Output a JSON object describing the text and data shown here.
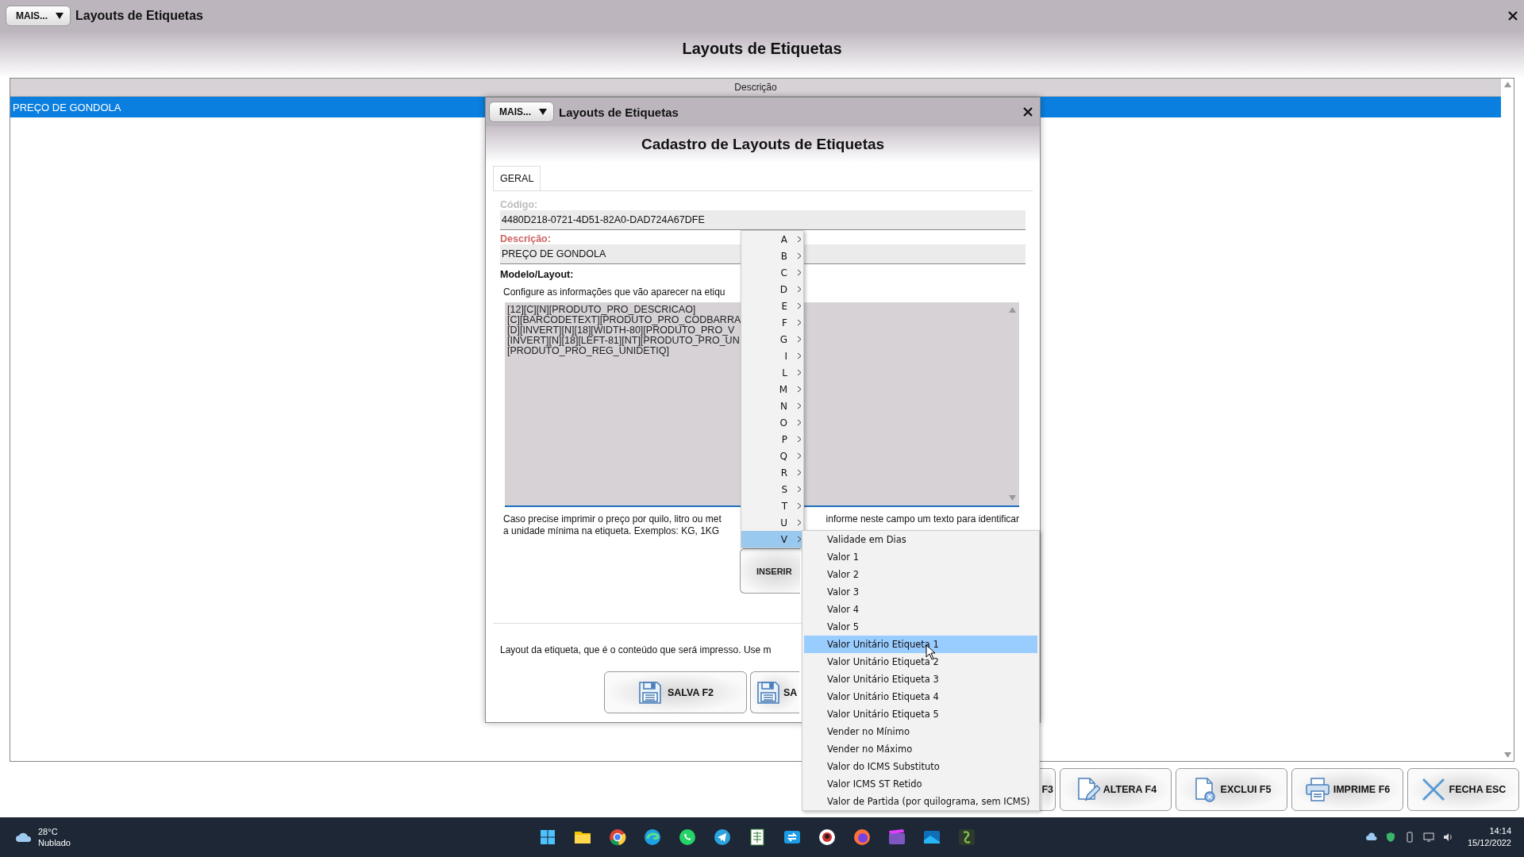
{
  "main_window": {
    "menu_button": "MAIS...",
    "title": "Layouts de Etiquetas",
    "heading": "Layouts de Etiquetas",
    "table": {
      "columns": [
        "Descrição"
      ],
      "rows": [
        {
          "cells": [
            "PREÇO DE GONDOLA"
          ],
          "selected": true
        }
      ]
    },
    "toolbar": [
      {
        "label": "F3",
        "kind": "covered"
      },
      {
        "label": "ALTERA F4",
        "kind": "edit"
      },
      {
        "label": "EXCLUI F5",
        "kind": "delete"
      },
      {
        "label": "IMPRIME F6",
        "kind": "print"
      },
      {
        "label": "FECHA ESC",
        "kind": "close"
      }
    ]
  },
  "dialog": {
    "menu_button": "MAIS...",
    "title": "Layouts de Etiquetas",
    "heading": "Cadastro de Layouts de Etiquetas",
    "tabs": [
      {
        "label": "GERAL",
        "selected": true
      }
    ],
    "fields": [
      {
        "label": "Código:",
        "value": "4480D218-0721-4D51-82A0-DAD724A67DFE",
        "required": false
      },
      {
        "label": "Descrição:",
        "value": "PREÇO DE GONDOLA",
        "required": true
      }
    ],
    "layout_label": "Modelo/Layout:",
    "layout_hint": "Configure as informações que vão aparecer na etiqu",
    "layout_lines": [
      "[12][C][N][PRODUTO_PRO_DESCRICAO]",
      "[C][BARCODETEXT][PRODUTO_PRO_CODBARRA",
      "[D][INVERT][N][18][WIDTH-80][PRODUTO_PRO_V",
      "[INVERT][N][18][LEFT-81][NT][PRODUTO_PRO_UN",
      "[PRODUTO_PRO_REG_UNIDETIQ]"
    ],
    "unit_hint_left": [
      "Caso precise imprimir o preço por quilo, litro ou met",
      "a unidade mínima na etiqueta. Exemplos: KG, 1KG"
    ],
    "unit_hint_right": "informe neste campo um texto para identificar",
    "insert_button": "INSERIR",
    "footer_note": "Layout da etiqueta, que é o conteúdo que será impresso. Use m",
    "buttons": [
      {
        "label": "SALVA F2"
      },
      {
        "label": "SA"
      }
    ]
  },
  "context_menu": {
    "items": [
      {
        "label": "A",
        "selected": false
      },
      {
        "label": "B",
        "selected": false
      },
      {
        "label": "C",
        "selected": false
      },
      {
        "label": "D",
        "selected": false
      },
      {
        "label": "E",
        "selected": false
      },
      {
        "label": "F",
        "selected": false
      },
      {
        "label": "G",
        "selected": false
      },
      {
        "label": "I",
        "selected": false
      },
      {
        "label": "L",
        "selected": false
      },
      {
        "label": "M",
        "selected": false
      },
      {
        "label": "N",
        "selected": false
      },
      {
        "label": "O",
        "selected": false
      },
      {
        "label": "P",
        "selected": false
      },
      {
        "label": "Q",
        "selected": false
      },
      {
        "label": "R",
        "selected": false
      },
      {
        "label": "S",
        "selected": false
      },
      {
        "label": "T",
        "selected": false
      },
      {
        "label": "U",
        "selected": false
      },
      {
        "label": "V",
        "selected": true
      }
    ]
  },
  "submenu": {
    "items": [
      {
        "label": "Validade em Dias",
        "selected": false
      },
      {
        "label": "Valor 1",
        "selected": false
      },
      {
        "label": "Valor 2",
        "selected": false
      },
      {
        "label": "Valor 3",
        "selected": false
      },
      {
        "label": "Valor 4",
        "selected": false
      },
      {
        "label": "Valor 5",
        "selected": false
      },
      {
        "label": "Valor Unitário Etiqueta 1",
        "selected": true
      },
      {
        "label": "Valor Unitário Etiqueta 2",
        "selected": false
      },
      {
        "label": "Valor Unitário Etiqueta 3",
        "selected": false
      },
      {
        "label": "Valor Unitário Etiqueta 4",
        "selected": false
      },
      {
        "label": "Valor Unitário Etiqueta 5",
        "selected": false
      },
      {
        "label": "Vender no Mínimo",
        "selected": false
      },
      {
        "label": "Vender no Máximo",
        "selected": false
      },
      {
        "label": "Valor do ICMS Substituto",
        "selected": false
      },
      {
        "label": "Valor ICMS ST Retido",
        "selected": false
      },
      {
        "label": "Valor de Partida (por quilograma, sem ICMS)",
        "selected": false
      }
    ]
  },
  "taskbar": {
    "temperature": "28°C",
    "condition": "Nublado",
    "time": "14:14",
    "date": "15/12/2022"
  }
}
